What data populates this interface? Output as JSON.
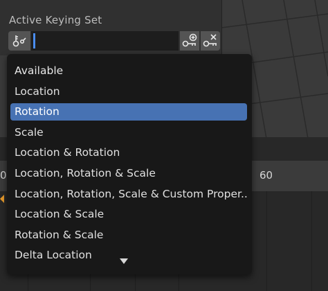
{
  "panel": {
    "title": "Active Keying Set",
    "field_icon": "keying-set-icon",
    "add_icon": "key-add-icon",
    "remove_icon": "key-remove-icon"
  },
  "timeline": {
    "frame_left": "0",
    "frame_right": "60"
  },
  "dropdown": {
    "header": "Available",
    "items": [
      "Location",
      "Rotation",
      "Scale",
      "Location & Rotation",
      "Location, Rotation & Scale",
      "Location, Rotation, Scale & Custom Proper...",
      "Location & Scale",
      "Rotation & Scale",
      "Delta Location"
    ],
    "selected": "Rotation",
    "scroll_icon": "scroll-down-icon"
  },
  "colors": {
    "accent": "#4772b3",
    "keyframe": "#e89b2c"
  }
}
